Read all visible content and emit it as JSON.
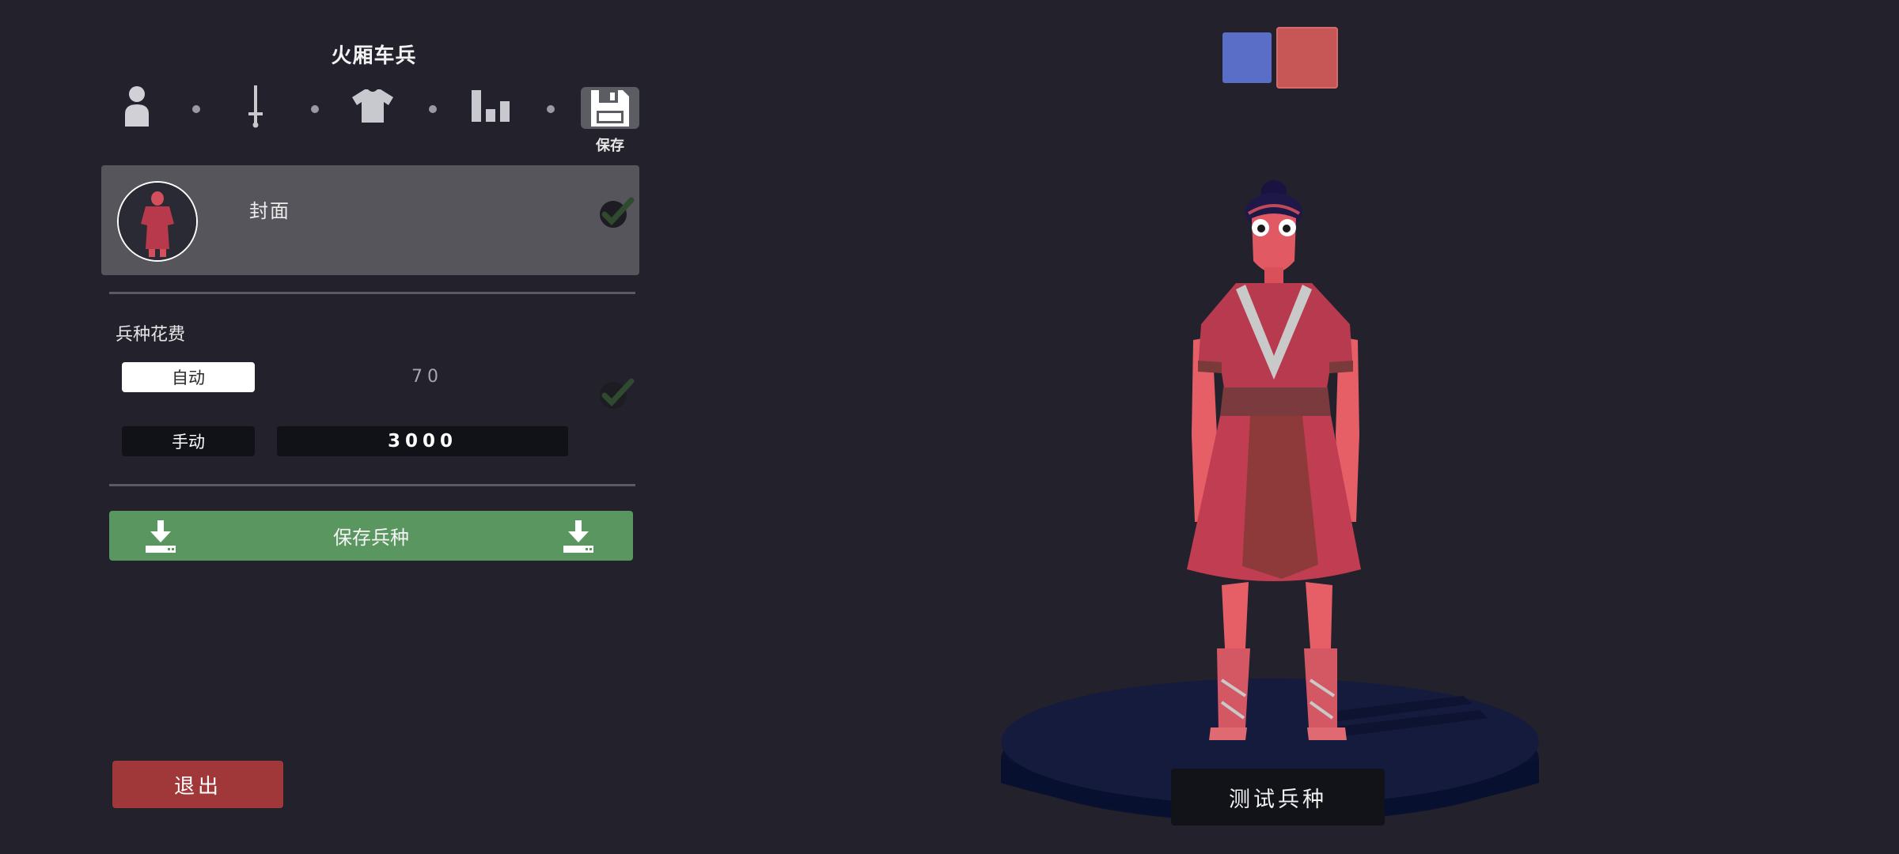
{
  "header": {
    "title": "火厢车兵"
  },
  "steps": {
    "items": [
      {
        "icon": "person-icon"
      },
      {
        "icon": "sword-icon"
      },
      {
        "icon": "shirt-icon"
      },
      {
        "icon": "bar-chart-icon"
      },
      {
        "icon": "floppy-disk-icon",
        "label": "保存"
      }
    ]
  },
  "cover": {
    "label": "封面",
    "checked": true
  },
  "cost": {
    "title": "兵种花费",
    "auto_label": "自动",
    "auto_value": "70",
    "manual_label": "手动",
    "manual_value": "3000"
  },
  "actions": {
    "save_unit": "保存兵种",
    "exit": "退出",
    "test_unit": "测试兵种"
  },
  "team_colors": {
    "blue": "#5a6ec8",
    "red": "#c75656"
  },
  "colors": {
    "background": "#22212c",
    "save_green": "#5a9660",
    "exit_red": "#a0383a",
    "check_green": "#2f4a2f"
  }
}
